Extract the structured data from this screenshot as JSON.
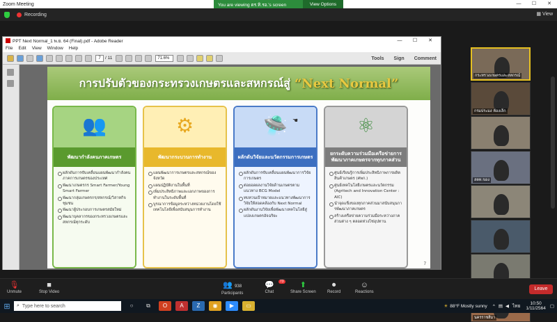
{
  "window": {
    "title": "Zoom Meeting",
    "minimize": "—",
    "maximize": "☐",
    "close": "✕"
  },
  "status": {
    "recording": "Recording",
    "view_label": "View"
  },
  "share_banner": {
    "text": "You are viewing ดร.ทิ.รอ.'s screen",
    "options": "View Options"
  },
  "reader": {
    "title": "PPT Next Normal_1 พ.ย. 64 (Final).pdf - Adobe Reader",
    "menu": [
      "File",
      "Edit",
      "View",
      "Window",
      "Help"
    ],
    "page_current": "7",
    "page_total": "/ 11",
    "zoom": "71.6%",
    "right_tools": [
      "Tools",
      "Sign",
      "Comment"
    ]
  },
  "slide": {
    "title_thai": "การปรับตัวของกระทรวงเกษตรและสหกรณ์สู่",
    "title_eng": "“Next Normal”",
    "page_number": "7",
    "cards": [
      {
        "icon": "👥",
        "header": "พัฒนากำลังคนภาคเกษตร",
        "items": [
          "ผลักดันการขับเคลื่อนแผนพัฒนากำลังคนภาคการเกษตรของประเทศ",
          "พัฒนาเกษตรกร Smart Farmer/Young Smart Farmer",
          "พัฒนากลุ่มเกษตรกร/สหกรณ์/วิสาหกิจชุมชน",
          "พัฒนาผู้ประกอบการเกษตรสมัยใหม่",
          "พัฒนาบุคลากรของกระทรวงเกษตรและสหกรณ์ทุกระดับ"
        ]
      },
      {
        "icon": "⚙",
        "header": "พัฒนากระบวนการทำงาน",
        "items": [
          "แผนพัฒนาการเกษตรและสหกรณ์ของจังหวัด",
          "แผนปฏิบัติงานในพื้นที่",
          "เพิ่มประสิทธิภาพและเอกภาพของการทำงานในระดับพื้นที่",
          "บูรณาการข้อมูลระหว่างหน่วยงานโดยใช้เทคโนโลยีเพื่อสนับสนุนการทำงาน"
        ]
      },
      {
        "icon": "🛸",
        "header": "ผลักดันวิจัยและนวัตกรรมการเกษตร",
        "items": [
          "ผลักดันการขับเคลื่อนแผนพัฒนาการวิจัยการเกษตร",
          "ต่อยอดผลงานวิจัยด้านเกษตรตามแนวทาง BCG Model",
          "ทบทวนเป้าหมายและแนวทางพัฒนาการวิจัยให้สอดคล้องกับ Next Normal",
          "ผลักดันงานวิจัยเพื่อพัฒนาเทคโนโลยีสู่แปลงเกษตรอัจฉริยะ"
        ]
      },
      {
        "icon": "⚛",
        "header": "ยกระดับความร่วมมือเครือข่ายการพัฒนาภาคเกษตรจากทุกภาคส่วน",
        "items": [
          "ศูนย์เรียนรู้การเพิ่มประสิทธิภาพการผลิตสินค้าเกษตร (ศพก.)",
          "ศูนย์เทคโนโลยีเกษตรและนวัตกรรม (Agritech and Innovation Center : AIC)",
          "นำจุดแข็งของทุกภาคส่วนมาสนับสนุนการพัฒนาภาคเกษตร",
          "สร้างเครือข่ายความร่วมมือระหว่างภาคส่วนต่าง ๆ ตลอดห่วงโซ่อุปทาน"
        ]
      }
    ]
  },
  "participants_gallery": [
    {
      "label": "กระทรวงเกษตรและสหกรณ์",
      "bg": "#7a6a58"
    },
    {
      "label": "กรมประมง ห้องเล็ก",
      "bg": "#5a4a3a"
    },
    {
      "label": "",
      "bg": "#8a8070"
    },
    {
      "label": "สตท.ของ",
      "bg": "#6a7080"
    },
    {
      "label": "",
      "bg": "#8c8678"
    },
    {
      "label": "",
      "bg": "#4a5a6a"
    },
    {
      "label": "ชลบุรี",
      "bg": "#7a7a70"
    },
    {
      "label": "นครราชสีมา",
      "bg": "#9a6a4a"
    }
  ],
  "controls": {
    "unmute": "Unmute",
    "stop_video": "Stop Video",
    "participants": "Participants",
    "participants_count": "938",
    "chat": "Chat",
    "chat_badge": "73",
    "share_screen": "Share Screen",
    "record": "Record",
    "reactions": "Reactions",
    "leave": "Leave"
  },
  "taskbar": {
    "search_placeholder": "Type here to search",
    "weather": "88°F  Mostly sunny",
    "lang": "ไทย",
    "time": "10:50",
    "date": "1/11/2564"
  }
}
